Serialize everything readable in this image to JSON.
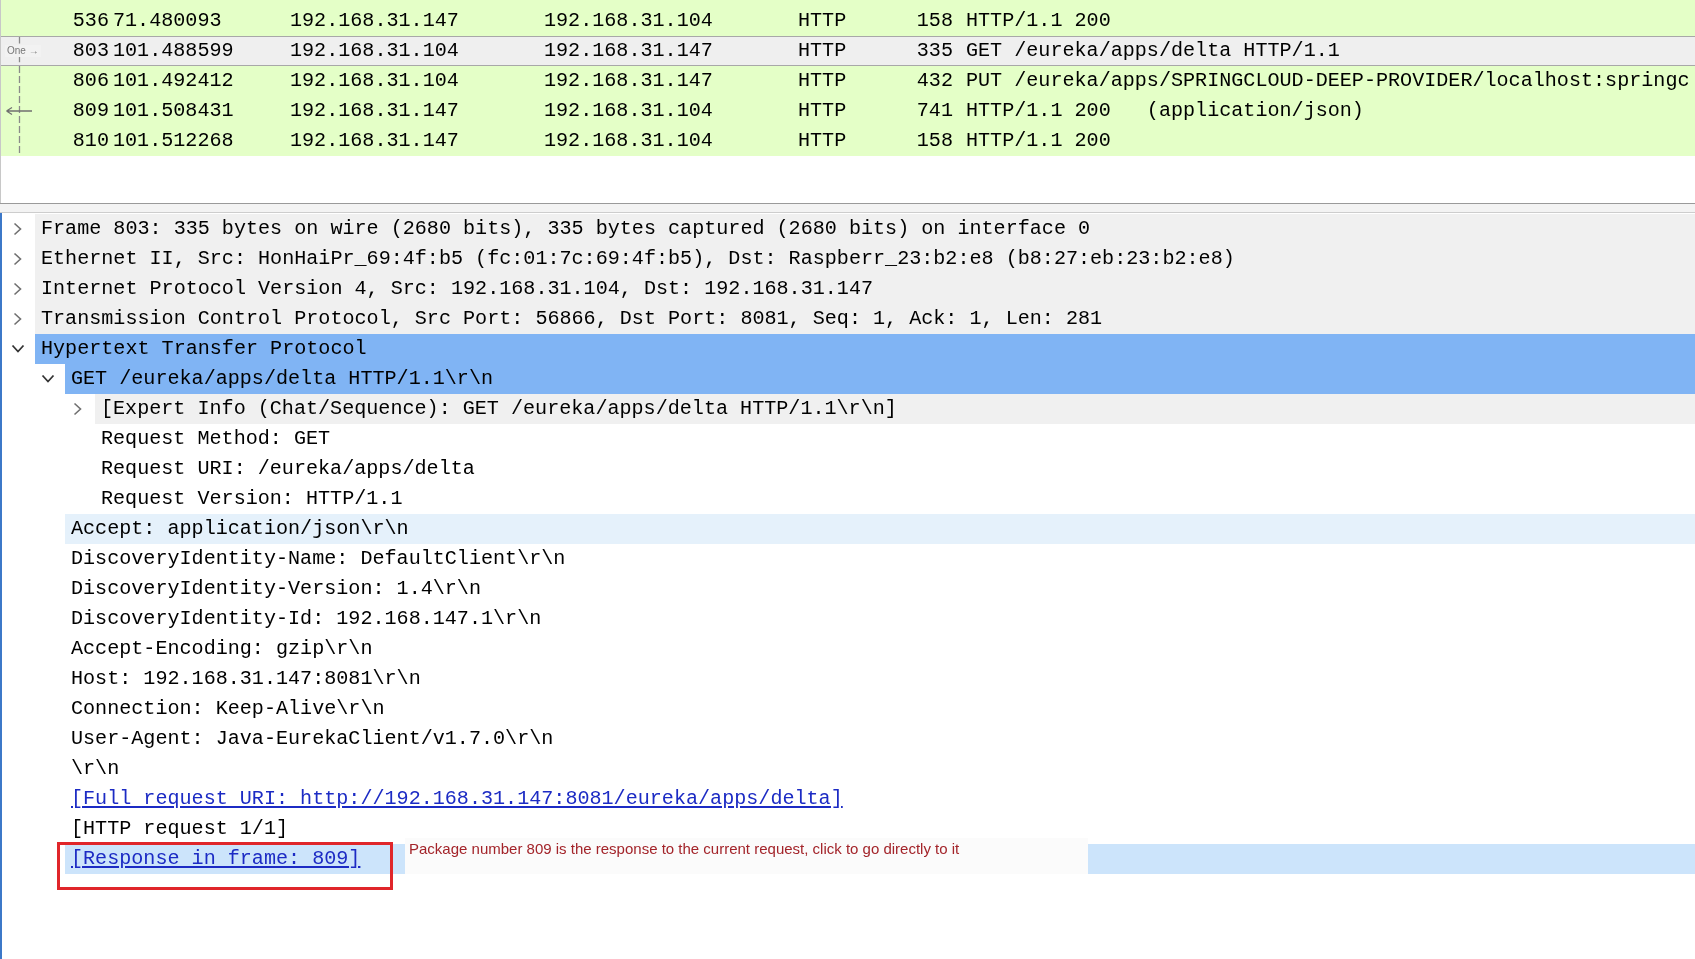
{
  "packet_list": {
    "rows": [
      {
        "cells": [
          "536",
          "71.480093",
          "192.168.31.147",
          "192.168.31.104",
          "HTTP",
          "158",
          "HTTP/1.1 200"
        ],
        "selected": false,
        "related": false
      },
      {
        "cells": [
          "803",
          "101.488599",
          "192.168.31.104",
          "192.168.31.147",
          "HTTP",
          "335",
          "GET /eureka/apps/delta HTTP/1.1"
        ],
        "selected": true,
        "related": true,
        "gutter": {
          "kind": "label",
          "text": "One →"
        }
      },
      {
        "cells": [
          "806",
          "101.492412",
          "192.168.31.104",
          "192.168.31.147",
          "HTTP",
          "432",
          "PUT /eureka/apps/SPRINGCLOUD-DEEP-PROVIDER/localhost:springc"
        ],
        "selected": false,
        "related": true
      },
      {
        "cells": [
          "809",
          "101.508431",
          "192.168.31.147",
          "192.168.31.104",
          "HTTP",
          "741",
          "HTTP/1.1 200   (application/json)"
        ],
        "selected": false,
        "related": true,
        "gutter": {
          "kind": "arrow"
        }
      },
      {
        "cells": [
          "810",
          "101.512268",
          "192.168.31.147",
          "192.168.31.104",
          "HTTP",
          "158",
          "HTTP/1.1 200"
        ],
        "selected": false,
        "related": true
      }
    ]
  },
  "detail_tree": {
    "items": [
      {
        "kind": "field",
        "text": "Frame 803: 335 bytes on wire (2680 bits), 335 bytes captured (2680 bits) on interface 0",
        "selected": false,
        "expanded": false
      },
      {
        "kind": "field",
        "text": "Ethernet II, Src: HonHaiPr_69:4f:b5 (fc:01:7c:69:4f:b5), Dst: Raspberr_23:b2:e8 (b8:27:eb:23:b2:e8)",
        "selected": false,
        "expanded": false
      },
      {
        "kind": "field",
        "text": "Internet Protocol Version 4, Src: 192.168.31.104, Dst: 192.168.31.147",
        "selected": false,
        "expanded": false
      },
      {
        "kind": "field",
        "text": "Transmission Control Protocol, Src Port: 56866, Dst Port: 8081, Seq: 1, Ack: 1, Len: 281",
        "selected": false,
        "expanded": false
      },
      {
        "kind": "field",
        "text": "Hypertext Transfer Protocol",
        "selected": true,
        "expanded": true,
        "children": [
          {
            "kind": "field",
            "text": "GET /eureka/apps/delta HTTP/1.1\\r\\n",
            "selected": true,
            "expanded": true,
            "children": [
              {
                "kind": "field",
                "text": "[Expert Info (Chat/Sequence): GET /eureka/apps/delta HTTP/1.1\\r\\n]",
                "selected": false,
                "expanded": false
              },
              {
                "kind": "field",
                "text": "Request Method: GET",
                "selected": false
              },
              {
                "kind": "field",
                "text": "Request URI: /eureka/apps/delta",
                "selected": false
              },
              {
                "kind": "field",
                "text": "Request Version: HTTP/1.1",
                "selected": false
              }
            ]
          },
          {
            "kind": "field",
            "text": "Accept: application/json\\r\\n",
            "selected": false,
            "focused": true
          },
          {
            "kind": "field",
            "text": "DiscoveryIdentity-Name: DefaultClient\\r\\n",
            "selected": false
          },
          {
            "kind": "field",
            "text": "DiscoveryIdentity-Version: 1.4\\r\\n",
            "selected": false
          },
          {
            "kind": "field",
            "text": "DiscoveryIdentity-Id: 192.168.147.1\\r\\n",
            "selected": false
          },
          {
            "kind": "field",
            "text": "Accept-Encoding: gzip\\r\\n",
            "selected": false
          },
          {
            "kind": "field",
            "text": "Host: 192.168.31.147:8081\\r\\n",
            "selected": false
          },
          {
            "kind": "field",
            "text": "Connection: Keep-Alive\\r\\n",
            "selected": false
          },
          {
            "kind": "field",
            "text": "User-Agent: Java-EurekaClient/v1.7.0\\r\\n",
            "selected": false
          },
          {
            "kind": "field",
            "text": "\\r\\n",
            "selected": false
          },
          {
            "kind": "link",
            "text": "[Full request URI: http://192.168.31.147:8081/eureka/apps/delta]",
            "selected": false
          },
          {
            "kind": "field",
            "text": "[HTTP request 1/1]",
            "selected": false
          },
          {
            "kind": "link",
            "text": "[Response in frame: 809]",
            "selected": false,
            "hovered": true,
            "boxed": true,
            "note": "Package number 809 is the response to the current request, click to go directly to it"
          }
        ]
      }
    ]
  }
}
